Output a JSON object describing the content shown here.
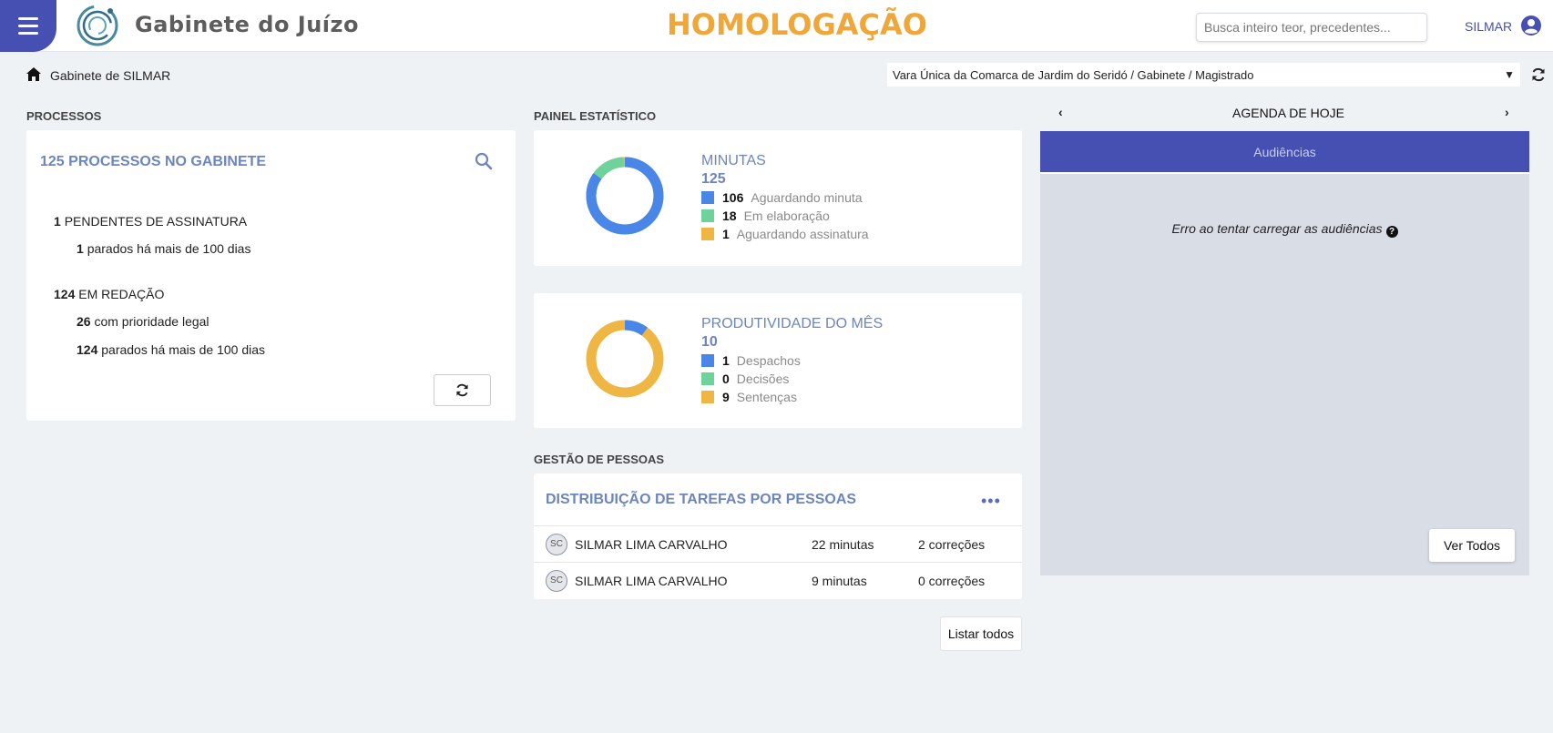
{
  "header": {
    "app_title": "Gabinete do Juízo",
    "environment": "HOMOLOGAÇÃO",
    "search_placeholder": "Busca inteiro teor, precedentes...",
    "user_name": "SILMAR",
    "accent_color": "#4650b3",
    "environment_color": "#f0a73a"
  },
  "breadcrumb": {
    "label": "Gabinete de SILMAR",
    "unit_selected": "Vara Única da Comarca de Jardim do Seridó / Gabinete / Magistrado"
  },
  "processos": {
    "section_title": "PROCESSOS",
    "heading": "125 PROCESSOS NO GABINETE",
    "pendentes": {
      "count": "1",
      "label": "PENDENTES DE ASSINATURA"
    },
    "pendentes_parados": {
      "count": "1",
      "label": "parados há mais de 100 dias"
    },
    "redacao": {
      "count": "124",
      "label": "EM REDAÇÃO"
    },
    "redacao_prioridade": {
      "count": "26",
      "label": "com prioridade legal"
    },
    "redacao_parados": {
      "count": "124",
      "label": "parados há mais de 100 dias"
    }
  },
  "painel": {
    "section_title": "PAINEL ESTATÍSTICO",
    "minutas": {
      "title": "MINUTAS",
      "total": "125",
      "items": [
        {
          "value": "106",
          "label": "Aguardando minuta",
          "color": "#4a86e8"
        },
        {
          "value": "18",
          "label": "Em elaboração",
          "color": "#6ed39a"
        },
        {
          "value": "1",
          "label": "Aguardando assinatura",
          "color": "#f0b644"
        }
      ]
    },
    "produtividade": {
      "title": "PRODUTIVIDADE DO MÊS",
      "total": "10",
      "items": [
        {
          "value": "1",
          "label": "Despachos",
          "color": "#4a86e8"
        },
        {
          "value": "0",
          "label": "Decisões",
          "color": "#6ed39a"
        },
        {
          "value": "9",
          "label": "Sentenças",
          "color": "#f0b644"
        }
      ]
    }
  },
  "gestao": {
    "section_title": "GESTÃO DE PESSOAS",
    "heading": "DISTRIBUIÇÃO DE TAREFAS POR PESSOAS",
    "rows": [
      {
        "initials": "SC",
        "name": "SILMAR LIMA CARVALHO",
        "minutas": "22 minutas",
        "correcoes": "2 correções"
      },
      {
        "initials": "SC",
        "name": "SILMAR LIMA CARVALHO",
        "minutas": "9 minutas",
        "correcoes": "0 correções"
      }
    ],
    "list_all_label": "Listar todos"
  },
  "agenda": {
    "title": "AGENDA DE HOJE",
    "tab_label": "Audiências",
    "error_message": "Erro ao tentar carregar as audiências",
    "view_all_label": "Ver Todos"
  }
}
